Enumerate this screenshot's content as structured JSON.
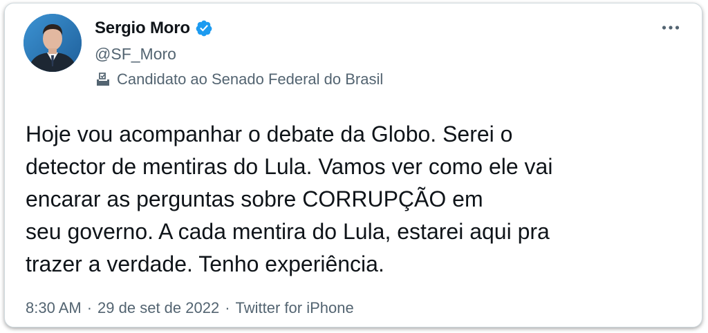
{
  "author": {
    "name": "Sergio Moro",
    "handle": "@SF_Moro",
    "verified": true,
    "label": "Candidato ao Senado Federal do Brasil",
    "label_icon": "ballot-box-icon"
  },
  "tweet": {
    "lines": [
      "Hoje vou acompanhar o debate da Globo. Serei o",
      "detector de mentiras do Lula. Vamos ver como ele vai",
      "encarar as perguntas sobre CORRUPÇÃO em",
      "seu governo. A cada mentira do Lula, estarei aqui pra",
      "trazer a verdade. Tenho experiência."
    ]
  },
  "meta": {
    "time": "8:30 AM",
    "separator": "·",
    "date": "29 de set de 2022",
    "source": "Twitter for iPhone"
  },
  "colors": {
    "text": "#0f1419",
    "secondary": "#536471",
    "verified_blue": "#1d9bf0",
    "border": "#cfd9de"
  },
  "icons": {
    "more": "more-horizontal-icon",
    "verified": "verified-badge-icon"
  }
}
